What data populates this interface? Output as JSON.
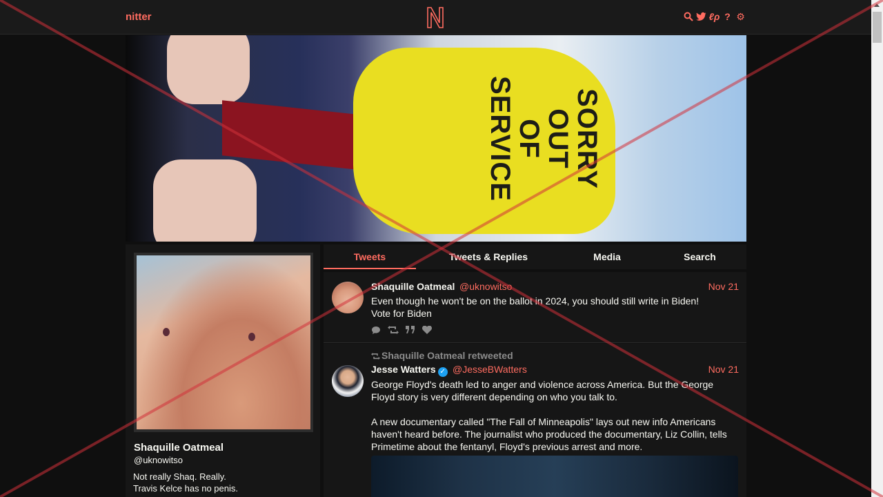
{
  "topbar": {
    "brand": "nitter",
    "logo_icon": "nitter-logo-icon",
    "icons": [
      "search-icon",
      "twitter-icon",
      "rss-icon",
      "help-icon",
      "gear-icon"
    ]
  },
  "banner": {
    "sign_line_1": "SORRY",
    "sign_line_2": "OUT",
    "sign_line_3": "OF",
    "sign_line_4": "SERVICE"
  },
  "profile": {
    "name": "Shaquille Oatmeal",
    "handle": "@uknowitso",
    "bio_line_1": "Not really Shaq. Really.",
    "bio_line_2": "Travis Kelce has no penis."
  },
  "tabs": [
    {
      "label": "Tweets"
    },
    {
      "label": "Tweets & Replies"
    },
    {
      "label": "Media"
    },
    {
      "label": "Search"
    }
  ],
  "tweets": [
    {
      "name": "Shaquille Oatmeal",
      "handle": "@uknowitso",
      "date": "Nov 21",
      "text_line_1": "Even though he won't be on the ballot in 2024, you should still write in Biden!",
      "text_line_2": "Vote for Biden"
    },
    {
      "retweet_label": "Shaquille Oatmeal retweeted",
      "name": "Jesse Watters",
      "handle": "@JesseBWatters",
      "date": "Nov 21",
      "para_1": "George Floyd's death led to anger and violence across America. But the George Floyd story is very different depending on who you talk to.",
      "para_2": "A new documentary called \"The Fall of Minneapolis\" lays out new info Americans haven't heard before. The journalist who produced the documentary, Liz Collin, tells Primetime about the fentanyl, Floyd's previous arrest and more."
    }
  ],
  "colors": {
    "accent": "#ff6c60",
    "background": "#0f0f0f",
    "panel": "#161616"
  }
}
